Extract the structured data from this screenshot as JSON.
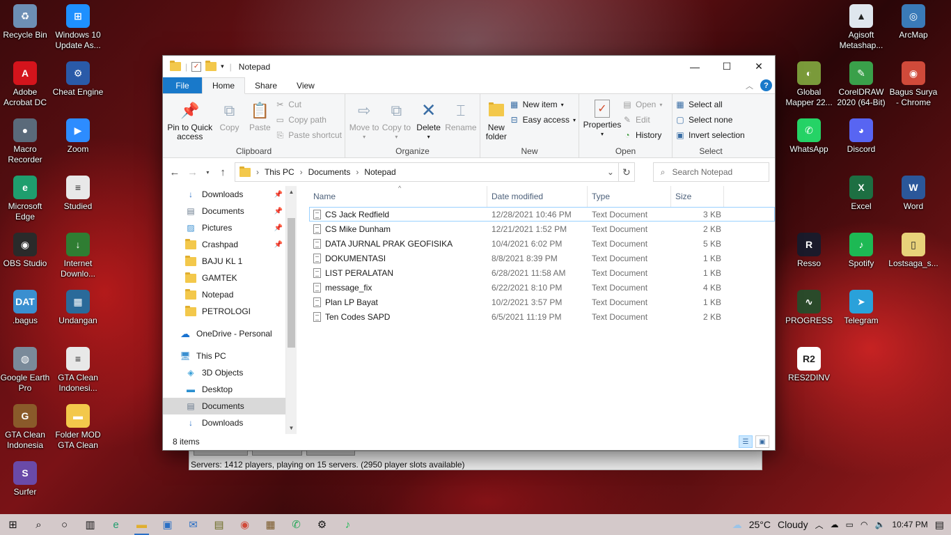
{
  "desktop": {
    "left_icons": [
      {
        "label": "Recycle Bin",
        "icon": "recycle-bin-icon",
        "color": "#6d8fb5"
      },
      {
        "label": "Windows 10 Update As...",
        "icon": "windows-update-icon",
        "color": "#1e90ff"
      },
      {
        "label": "Adobe Acrobat DC",
        "icon": "acrobat-icon",
        "color": "#d4141c"
      },
      {
        "label": "Cheat Engine",
        "icon": "cheat-engine-icon",
        "color": "#2a5aa8"
      },
      {
        "label": "Macro Recorder",
        "icon": "macro-recorder-icon",
        "color": "#5a6a7a"
      },
      {
        "label": "Zoom",
        "icon": "zoom-icon",
        "color": "#2d8cff"
      },
      {
        "label": "Microsoft Edge",
        "icon": "edge-icon",
        "color": "#1f9e6e"
      },
      {
        "label": "Studied",
        "icon": "text-file-icon",
        "color": "#e8e8e8"
      },
      {
        "label": "OBS Studio",
        "icon": "obs-icon",
        "color": "#2a2a2a"
      },
      {
        "label": "Internet Downlo...",
        "icon": "idm-icon",
        "color": "#2f7d32"
      },
      {
        "label": ".bagus",
        "icon": "dat-file-icon",
        "color": "#3a8fd0"
      },
      {
        "label": "Undangan",
        "icon": "image-app-icon",
        "color": "#2a6a9a"
      },
      {
        "label": "Google Earth Pro",
        "icon": "google-earth-icon",
        "color": "#7a8a9a"
      },
      {
        "label": "GTA Clean Indonesi...",
        "icon": "text-file-icon",
        "color": "#e8e8e8"
      },
      {
        "label": "GTA Clean Indonesia",
        "icon": "gta-icon",
        "color": "#8a5a2a"
      },
      {
        "label": "Folder MOD GTA Clean",
        "icon": "folder-icon",
        "color": "#f3c84b"
      },
      {
        "label": "Surfer",
        "icon": "surfer-icon",
        "color": "#6a4aa8"
      }
    ],
    "right_icons": [
      {
        "label": "Agisoft Metashap...",
        "icon": "agisoft-icon",
        "color": "#dfe6ee"
      },
      {
        "label": "ArcMap",
        "icon": "arcmap-icon",
        "color": "#3a7ab8"
      },
      {
        "label": "Global Mapper 22...",
        "icon": "global-mapper-icon",
        "color": "#7a9a3a"
      },
      {
        "label": "CorelDRAW 2020 (64-Bit)",
        "icon": "coreldraw-icon",
        "color": "#3aa04a"
      },
      {
        "label": "Bagus Surya - Chrome",
        "icon": "chrome-profile-icon",
        "color": "#d04a3a"
      },
      {
        "label": "WhatsApp",
        "icon": "whatsapp-icon",
        "color": "#25d366"
      },
      {
        "label": "Discord",
        "icon": "discord-icon",
        "color": "#5865f2"
      },
      {
        "label": "Excel",
        "icon": "excel-icon",
        "color": "#1d6f42"
      },
      {
        "label": "Word",
        "icon": "word-icon",
        "color": "#2b579a"
      },
      {
        "label": "Resso",
        "icon": "resso-icon",
        "color": "#1a1a2a"
      },
      {
        "label": "Spotify",
        "icon": "spotify-icon",
        "color": "#1db954"
      },
      {
        "label": "Lostsaga_s...",
        "icon": "file-icon",
        "color": "#e8d27a"
      },
      {
        "label": "PROGRESS",
        "icon": "progress-icon",
        "color": "#2a4a2a"
      },
      {
        "label": "Telegram",
        "icon": "telegram-icon",
        "color": "#2aa1da"
      },
      {
        "label": "RES2DINV",
        "icon": "res2dinv-icon",
        "color": "#ffffff"
      }
    ]
  },
  "window": {
    "title": "Notepad",
    "controls": {
      "minimize": "—",
      "maximize": "☐",
      "close": "✕"
    },
    "tabs": [
      "File",
      "Home",
      "Share",
      "View"
    ],
    "ribbon": {
      "clipboard": {
        "label": "Clipboard",
        "pin": "Pin to Quick access",
        "copy": "Copy",
        "paste": "Paste",
        "cut": "Cut",
        "copy_path": "Copy path",
        "paste_shortcut": "Paste shortcut"
      },
      "organize": {
        "label": "Organize",
        "move_to": "Move to",
        "copy_to": "Copy to",
        "delete": "Delete",
        "rename": "Rename"
      },
      "new": {
        "label": "New",
        "new_folder": "New folder",
        "new_item": "New item",
        "easy_access": "Easy access"
      },
      "open": {
        "label": "Open",
        "properties": "Properties",
        "open": "Open",
        "edit": "Edit",
        "history": "History"
      },
      "select": {
        "label": "Select",
        "select_all": "Select all",
        "select_none": "Select none",
        "invert": "Invert selection"
      }
    },
    "address": {
      "crumbs": [
        "This PC",
        "Documents",
        "Notepad"
      ],
      "search_placeholder": "Search Notepad"
    },
    "nav": {
      "quick": [
        {
          "label": "Downloads",
          "icon": "download-arrow-icon",
          "pinned": true
        },
        {
          "label": "Documents",
          "icon": "documents-icon",
          "pinned": true
        },
        {
          "label": "Pictures",
          "icon": "pictures-icon",
          "pinned": true
        },
        {
          "label": "Crashpad",
          "icon": "folder-icon",
          "pinned": true
        },
        {
          "label": "BAJU KL 1",
          "icon": "folder-icon",
          "pinned": false
        },
        {
          "label": "GAMTEK",
          "icon": "folder-icon",
          "pinned": false
        },
        {
          "label": "Notepad",
          "icon": "folder-icon",
          "pinned": false
        },
        {
          "label": "PETROLOGI",
          "icon": "folder-icon",
          "pinned": false
        }
      ],
      "onedrive": "OneDrive - Personal",
      "this_pc": "This PC",
      "pc_items": [
        {
          "label": "3D Objects",
          "icon": "3d-objects-icon"
        },
        {
          "label": "Desktop",
          "icon": "desktop-icon"
        },
        {
          "label": "Documents",
          "icon": "documents-icon",
          "selected": true
        },
        {
          "label": "Downloads",
          "icon": "download-arrow-icon"
        }
      ]
    },
    "columns": [
      "Name",
      "Date modified",
      "Type",
      "Size"
    ],
    "files": [
      {
        "name": "CS Jack Redfield",
        "date": "12/28/2021 10:46 PM",
        "type": "Text Document",
        "size": "3 KB",
        "selected": true
      },
      {
        "name": "CS Mike Dunham",
        "date": "12/21/2021 1:52 PM",
        "type": "Text Document",
        "size": "2 KB"
      },
      {
        "name": "DATA JURNAL PRAK GEOFISIKA",
        "date": "10/4/2021 6:02 PM",
        "type": "Text Document",
        "size": "5 KB"
      },
      {
        "name": "DOKUMENTASI",
        "date": "8/8/2021 8:39 PM",
        "type": "Text Document",
        "size": "1 KB"
      },
      {
        "name": "LIST PERALATAN",
        "date": "6/28/2021 11:58 AM",
        "type": "Text Document",
        "size": "1 KB"
      },
      {
        "name": "message_fix",
        "date": "6/22/2021 8:10 PM",
        "type": "Text Document",
        "size": "4 KB"
      },
      {
        "name": "Plan LP Bayat",
        "date": "10/2/2021 3:57 PM",
        "type": "Text Document",
        "size": "1 KB"
      },
      {
        "name": "Ten Codes SAPD",
        "date": "6/5/2021 11:19 PM",
        "type": "Text Document",
        "size": "2 KB"
      }
    ],
    "status": "8 items"
  },
  "background_app": {
    "message": "Servers: 1412 players, playing on 15 servers. (2950 player slots available)"
  },
  "taskbar": {
    "apps": [
      "start-icon",
      "search-icon",
      "cortana-icon",
      "task-view-icon",
      "edge-icon",
      "file-explorer-icon",
      "store-icon",
      "mail-icon",
      "notepad-icon",
      "chrome-icon",
      "game-icon",
      "whatsapp-icon",
      "settings-icon",
      "spotify-icon"
    ],
    "weather": {
      "temp": "25°C",
      "condition": "Cloudy"
    },
    "time": "10:47 PM"
  },
  "accent": "#1979ca"
}
